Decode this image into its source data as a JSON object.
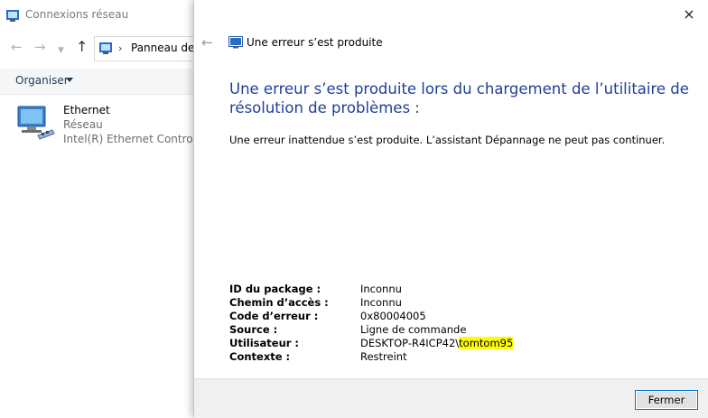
{
  "explorer": {
    "title": "Connexions réseau",
    "address_text": "Panneau de c",
    "organize_label": "Organiser",
    "connection": {
      "name": "Ethernet",
      "status": "Réseau",
      "adapter": "Intel(R) Ethernet Controller"
    }
  },
  "dialog": {
    "header_title": "Une erreur s’est produite",
    "heading": "Une erreur s’est produite lors du chargement de l’utilitaire de résolution de problèmes :",
    "message": "Une erreur inattendue s’est produite. L’assistant Dépannage ne peut pas continuer.",
    "details": {
      "package_id_label": "ID du package :",
      "package_id_value": "Inconnu",
      "path_label": "Chemin d’accès :",
      "path_value": "Inconnu",
      "error_code_label": "Code d’erreur :",
      "error_code_value": "0x80004005",
      "source_label": "Source :",
      "source_value": "Ligne de commande",
      "user_label": "Utilisateur :",
      "user_machine": "DESKTOP-R4ICP42\\",
      "user_name": "tomtom95",
      "context_label": "Contexte :",
      "context_value": "Restreint"
    },
    "close_button": "Fermer",
    "close_icon": "×"
  },
  "colors": {
    "heading_blue": "#1f3f99",
    "highlight": "#ffff00",
    "button_border": "#0078d7"
  },
  "icons": {
    "back": "back-arrow-icon",
    "forward": "forward-arrow-icon",
    "up": "up-arrow-icon",
    "network": "network-connection-icon",
    "control_panel": "control-panel-icon",
    "close": "close-icon"
  }
}
